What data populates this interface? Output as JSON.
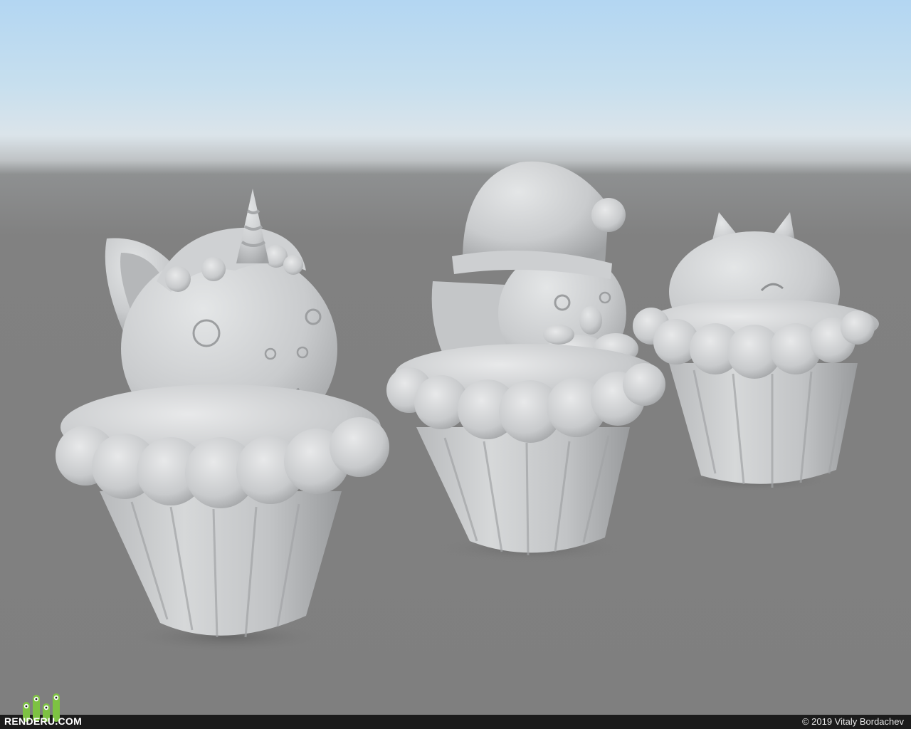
{
  "watermark": {
    "logo_text": "RENDERU.COM",
    "copyright": "© 2019 Vitaly Bordachev"
  },
  "scene": {
    "subjects": [
      "unicorn-cupcake",
      "santa-cupcake",
      "cat-cupcake"
    ],
    "colors": {
      "sky": "#b3d6f2",
      "floor": "#7f7f7f",
      "clay": "#d2d4d5",
      "clay_shadow": "#9a9c9e",
      "logo_green": "#7dc242"
    }
  }
}
